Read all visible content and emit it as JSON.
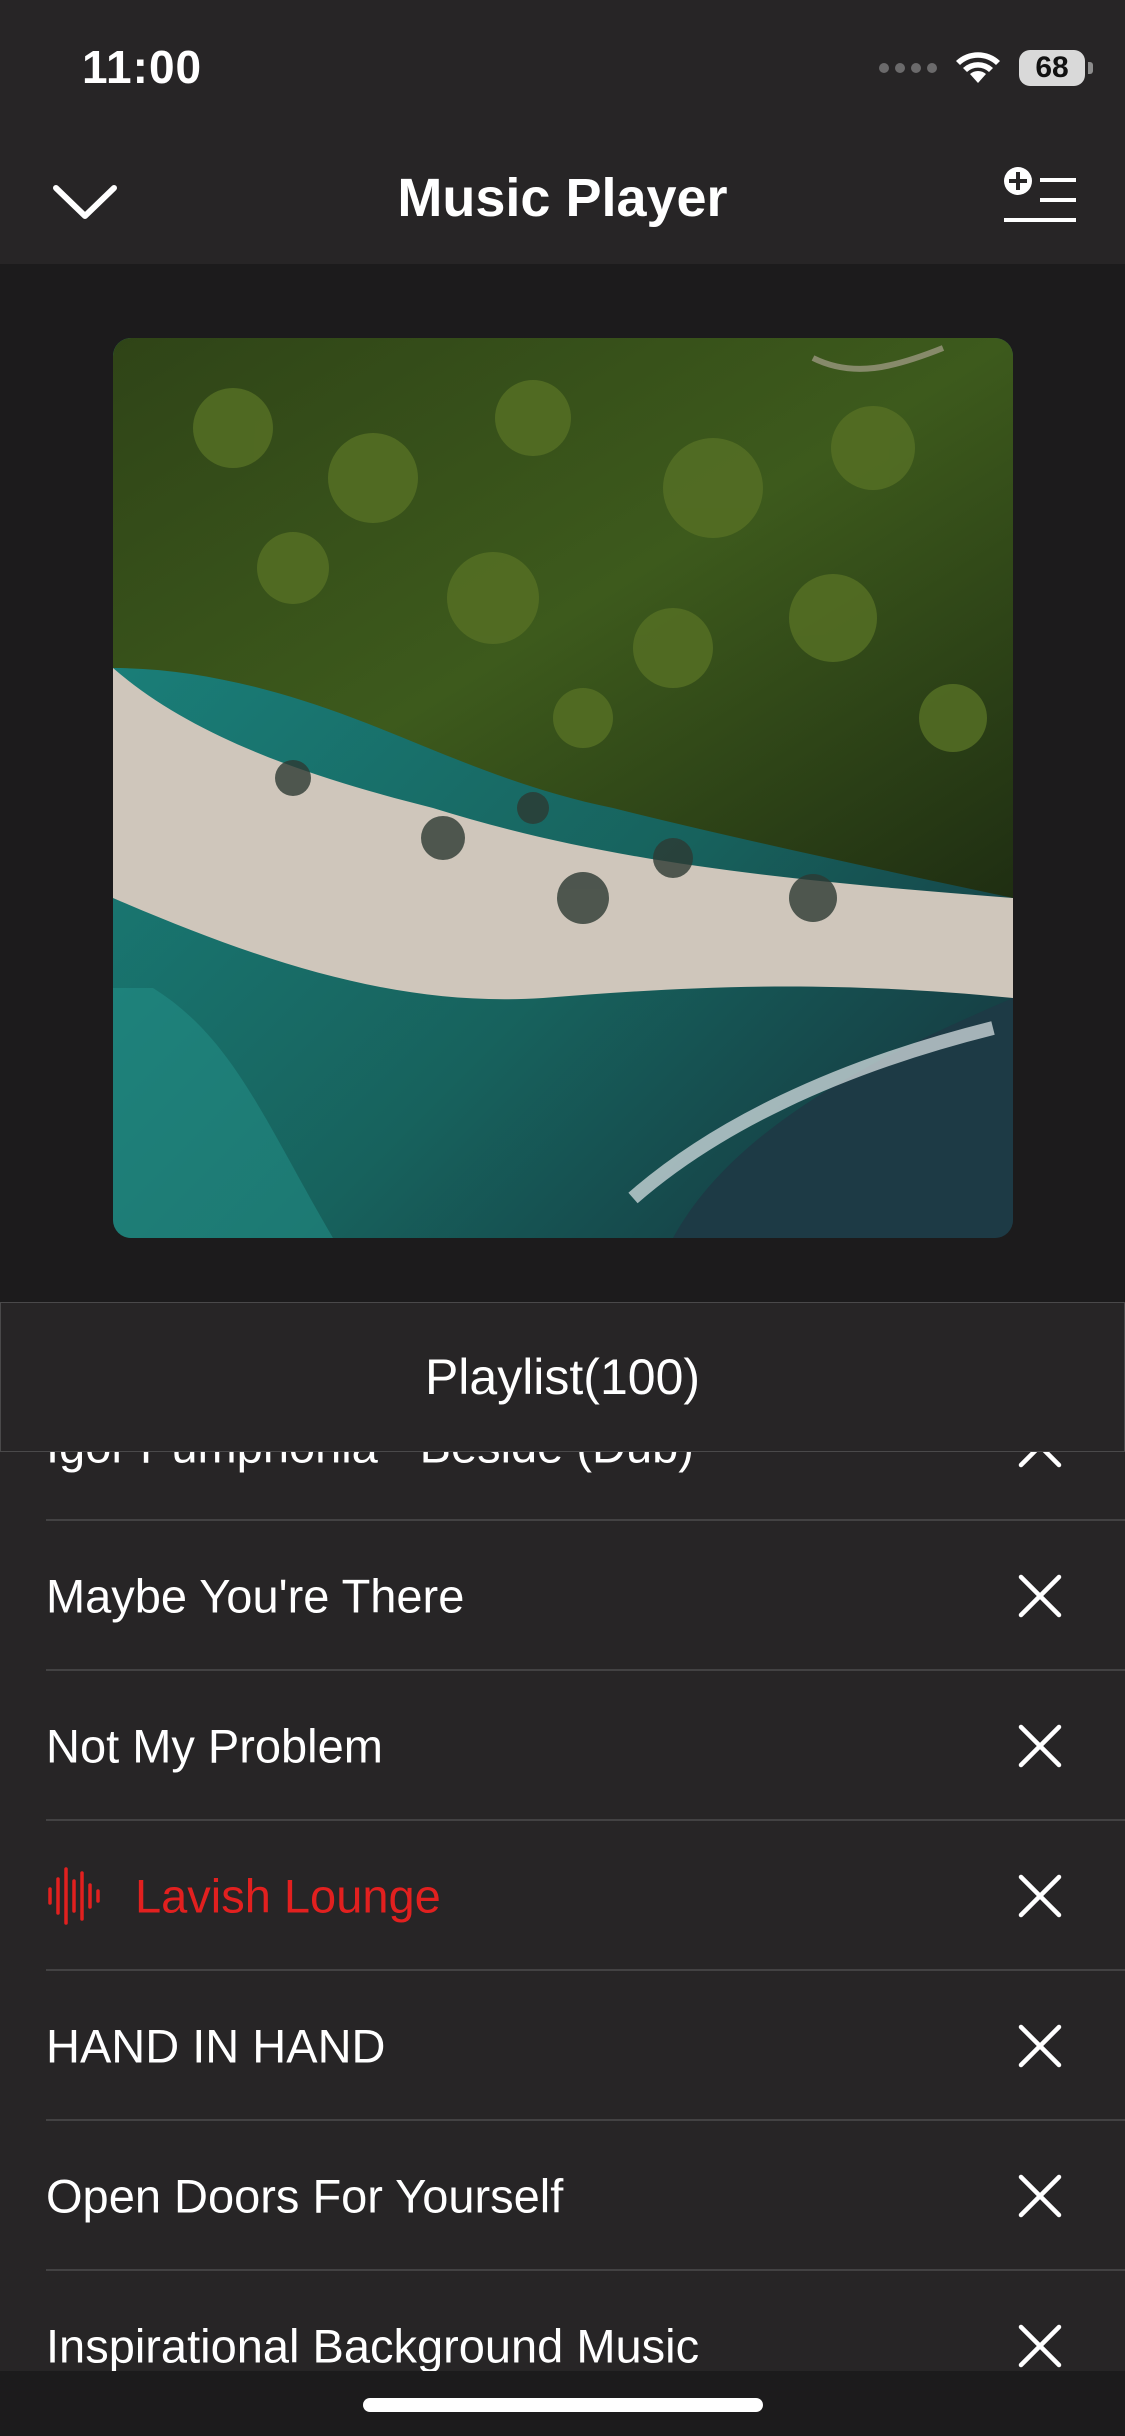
{
  "status_bar": {
    "time": "11:00",
    "battery": "68"
  },
  "nav": {
    "title": "Music Player"
  },
  "playlist": {
    "header": "Playlist(100)",
    "tracks": [
      {
        "title": "Igor Pumphonia - Beside (Dub)",
        "playing": false
      },
      {
        "title": "Maybe You're There",
        "playing": false
      },
      {
        "title": "Not My Problem",
        "playing": false
      },
      {
        "title": "Lavish Lounge",
        "playing": true
      },
      {
        "title": "HAND IN HAND",
        "playing": false
      },
      {
        "title": "Open Doors For Yourself",
        "playing": false
      },
      {
        "title": "Inspirational Background Music",
        "playing": false
      }
    ]
  },
  "colors": {
    "background": "#1c1b1c",
    "surface": "#272526",
    "playing_accent": "#e2201f"
  },
  "icons": {
    "nav_back": "chevron-down-icon",
    "nav_right": "add-to-queue-icon",
    "playing": "equalizer-icon",
    "remove": "close-icon"
  }
}
